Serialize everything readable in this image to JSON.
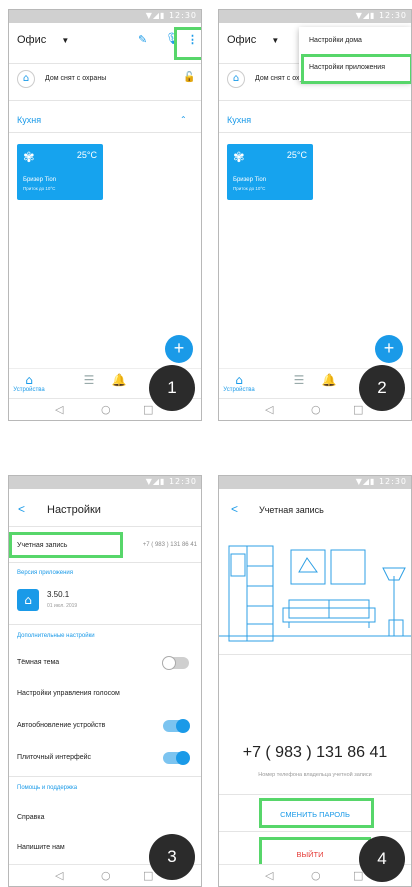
{
  "common": {
    "status_icons": "▼◢▮ 12:30",
    "home_title": "Офис",
    "security_status": "Дом снят с охраны",
    "room_name": "Кухня",
    "tile": {
      "name": "Бризер Tion",
      "temp": "25°C",
      "sub": "Приток до 10°C"
    },
    "tab_devices": "Устройства",
    "fab_label": "+"
  },
  "screen2": {
    "menu_items": [
      "Настройки дома",
      "Настройки приложения"
    ]
  },
  "screen3": {
    "title": "Настройки",
    "account_label": "Учетная запись",
    "account_phone": "+7 ( 983 ) 131 86 41",
    "version_section": "Версия приложения",
    "version": "3.50.1",
    "version_date": "01 июл. 2019",
    "extra_section": "Дополнительные настройки",
    "dark_theme": "Тёмная тема",
    "voice_settings": "Настройки управления голосом",
    "auto_update": "Автообновление устройств",
    "tile_ui": "Плиточный интерфейс",
    "help_section": "Помощь и поддержка",
    "help": "Справка",
    "write_us": "Напишите нам"
  },
  "screen4": {
    "title": "Учетная запись",
    "phone": "+7 ( 983 ) 131 86 41",
    "phone_caption": "Номер телефона владельца учетной записи",
    "change_password": "СМЕНИТЬ ПАРОЛЬ",
    "logout": "ВЫЙТИ"
  },
  "steps": [
    "1",
    "2",
    "3",
    "4"
  ],
  "colors": {
    "accent": "#1a9ae8",
    "highlight": "#57d66a",
    "logout": "#e53935",
    "badge": "#2b2b2b"
  }
}
